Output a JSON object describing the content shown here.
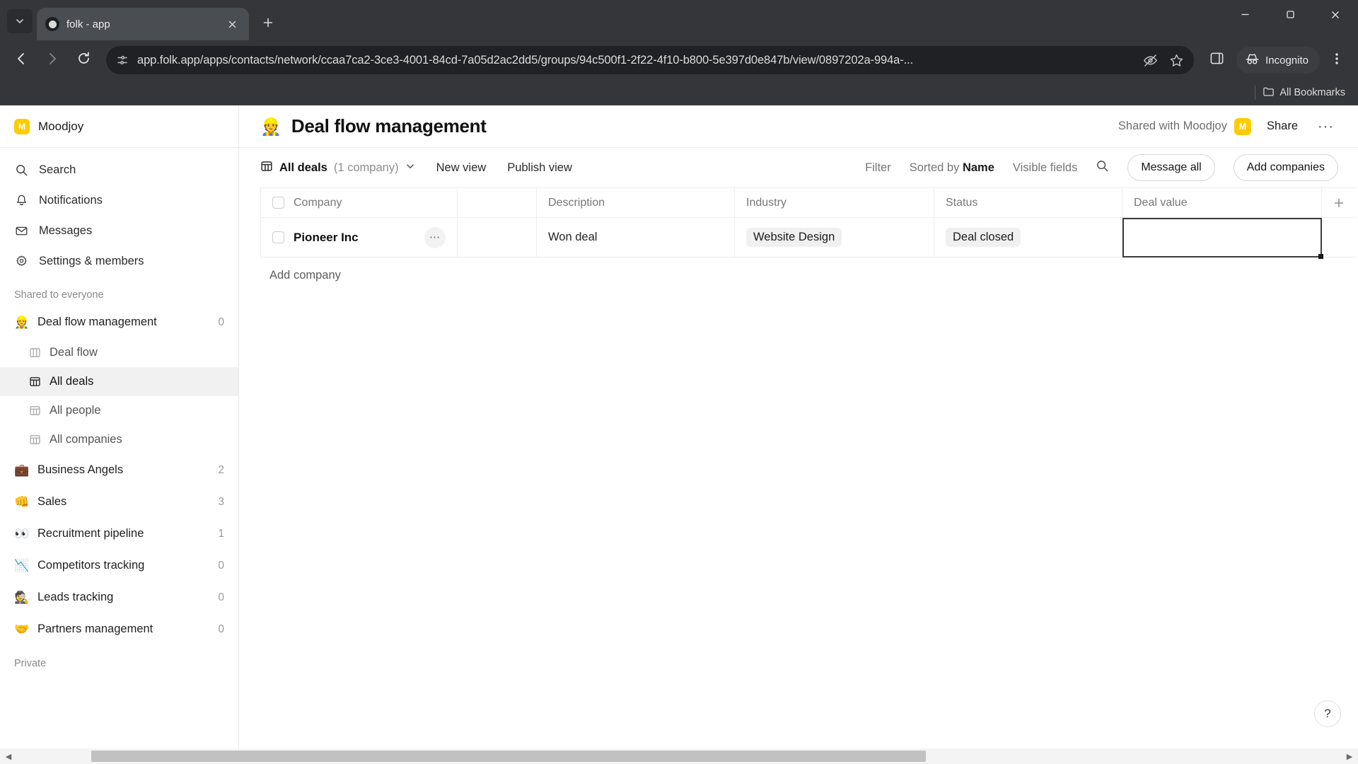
{
  "browser": {
    "tab": {
      "title": "folk - app",
      "favicon_icon": "folk-circle-icon",
      "close_icon": "close-icon"
    },
    "tab_list_icon": "chevron-down-icon",
    "new_tab_icon": "plus-icon",
    "window_controls": {
      "minimize": "minimize-icon",
      "maximize": "maximize-icon",
      "close": "window-close-icon"
    },
    "nav": {
      "back_icon": "back-arrow-icon",
      "forward_icon": "forward-arrow-icon",
      "reload_icon": "reload-icon"
    },
    "omnibox": {
      "site_info_icon": "page-info-icon",
      "url": "app.folk.app/apps/contacts/network/ccaa7ca2-3ce3-4001-84cd-7a05d2ac2dd5/groups/94c500f1-2f22-4f10-b800-5e397d0e847b/view/0897202a-994a-...",
      "tracking_icon": "eye-slash-icon",
      "bookmark_icon": "star-icon"
    },
    "side_panel_icon": "side-panel-icon",
    "incognito": {
      "label": "Incognito",
      "icon": "incognito-icon"
    },
    "menu_icon": "three-dot-menu-icon",
    "bookmarks_bar": {
      "label": "All Bookmarks",
      "icon": "folder-icon"
    }
  },
  "sidebar": {
    "workspace": {
      "name": "Moodjoy",
      "avatar_initial": "M",
      "avatar_color": "#FFCC00"
    },
    "nav": [
      {
        "label": "Search",
        "icon": "search-icon"
      },
      {
        "label": "Notifications",
        "icon": "bell-icon"
      },
      {
        "label": "Messages",
        "icon": "envelope-icon"
      },
      {
        "label": "Settings & members",
        "icon": "gear-icon"
      }
    ],
    "section_shared_label": "Shared to everyone",
    "section_private_label": "Private",
    "groups": [
      {
        "label": "Deal flow management",
        "emoji": "👷",
        "count": "0",
        "active": true
      },
      {
        "label": "Business Angels",
        "emoji": "💼",
        "count": "2",
        "active": false
      },
      {
        "label": "Sales",
        "emoji": "👊",
        "count": "3",
        "active": false
      },
      {
        "label": "Recruitment pipeline",
        "emoji": "👀",
        "count": "1",
        "active": false
      },
      {
        "label": "Competitors tracking",
        "emoji": "📉",
        "count": "0",
        "active": false
      },
      {
        "label": "Leads tracking",
        "emoji": "🕵️",
        "count": "0",
        "active": false
      },
      {
        "label": "Partners management",
        "emoji": "🤝",
        "count": "0",
        "active": false
      }
    ],
    "views": [
      {
        "label": "Deal flow",
        "icon": "board-icon",
        "active": false
      },
      {
        "label": "All deals",
        "icon": "table-icon",
        "active": true
      },
      {
        "label": "All people",
        "icon": "table-icon",
        "active": false
      },
      {
        "label": "All companies",
        "icon": "table-icon",
        "active": false
      }
    ]
  },
  "header": {
    "emoji": "👷",
    "title": "Deal flow management",
    "shared_with": "Shared with Moodjoy",
    "shared_avatar_initial": "M",
    "share_label": "Share",
    "more_label": "···"
  },
  "toolbar": {
    "view_icon": "table-icon",
    "view_name": "All deals",
    "view_count": "(1 company)",
    "view_chevron_icon": "chevron-down-icon",
    "new_view_label": "New view",
    "publish_view_label": "Publish view",
    "filter_label": "Filter",
    "sorted_by_prefix": "Sorted by ",
    "sorted_by_value": "Name",
    "visible_fields_label": "Visible fields",
    "search_icon": "search-icon",
    "message_all_label": "Message all",
    "add_companies_label": "Add companies"
  },
  "table": {
    "columns": [
      "Company",
      "",
      "Description",
      "Industry",
      "Status",
      "Deal value"
    ],
    "add_column_icon": "plus-icon",
    "rows": [
      {
        "company": "Pioneer Inc",
        "row_menu_icon": "ellipsis-icon",
        "blank": "",
        "description": "Won deal",
        "industry": "Website Design",
        "status": "Deal closed",
        "deal_value": ""
      }
    ],
    "add_company_label": "Add company"
  },
  "footer": {
    "help_label": "?",
    "scroll_left_icon": "caret-left-icon",
    "scroll_right_icon": "caret-right-icon"
  }
}
